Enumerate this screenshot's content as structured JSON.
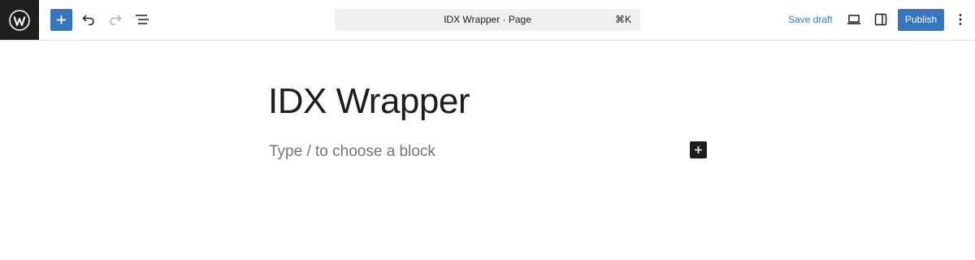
{
  "header": {
    "logo_icon": "wordpress-logo-icon",
    "toolbar_icons": [
      "plus-icon",
      "undo-icon",
      "redo-icon",
      "list-view-icon"
    ],
    "document_bar": {
      "title": "IDX Wrapper · Page",
      "shortcut": "⌘K"
    },
    "save_draft_label": "Save draft",
    "view_icons": [
      "desktop-view-icon",
      "sidebar-toggle-icon"
    ],
    "publish_label": "Publish",
    "options_icon": "more-vertical-icon",
    "colors": {
      "accent": "#3676c1",
      "logo_bg": "#1e1e1e"
    }
  },
  "editor": {
    "post_title": "IDX Wrapper",
    "block_placeholder": "Type / to choose a block",
    "block_add_icon": "plus-icon"
  }
}
